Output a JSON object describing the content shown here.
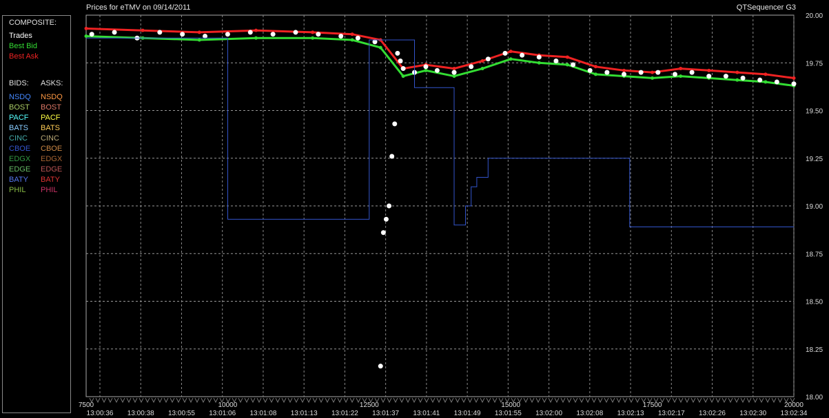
{
  "header": {
    "title": "Prices for  eTMV  on  09/14/2011",
    "app": "QTSequencer G3"
  },
  "legend": {
    "composite_heading": "COMPOSITE:",
    "composite": [
      {
        "label": "Trades",
        "color": "#ffffff"
      },
      {
        "label": "Best Bid",
        "color": "#33dd33"
      },
      {
        "label": "Best Ask",
        "color": "#ee2222"
      }
    ],
    "bids_heading": "BIDS:",
    "asks_heading": "ASKS:",
    "bids": [
      {
        "label": "NSDQ",
        "color": "#4488ff"
      },
      {
        "label": "BOST",
        "color": "#aacc66"
      },
      {
        "label": "PACF",
        "color": "#55ffff"
      },
      {
        "label": "BATS",
        "color": "#88ccff"
      },
      {
        "label": "CINC",
        "color": "#44aaaa"
      },
      {
        "label": "CBOE",
        "color": "#3355cc"
      },
      {
        "label": "EDGX",
        "color": "#339944"
      },
      {
        "label": "EDGE",
        "color": "#66bb66"
      },
      {
        "label": "BATY",
        "color": "#5577ee"
      },
      {
        "label": "PHIL",
        "color": "#88bb44"
      }
    ],
    "asks": [
      {
        "label": "NSDQ",
        "color": "#ff9944"
      },
      {
        "label": "BOST",
        "color": "#dd7766"
      },
      {
        "label": "PACF",
        "color": "#ffff44"
      },
      {
        "label": "BATS",
        "color": "#ffcc55"
      },
      {
        "label": "CINC",
        "color": "#bbaa77"
      },
      {
        "label": "CBOE",
        "color": "#cc8844"
      },
      {
        "label": "EDGX",
        "color": "#aa6633"
      },
      {
        "label": "EDGE",
        "color": "#bb5555"
      },
      {
        "label": "BATY",
        "color": "#dd3333"
      },
      {
        "label": "PHIL",
        "color": "#cc3366"
      }
    ]
  },
  "chart_data": {
    "type": "line",
    "ylim": [
      18.0,
      20.0
    ],
    "xlim": [
      7500,
      20000
    ],
    "yticks": [
      "20.00",
      "19.75",
      "19.50",
      "19.25",
      "19.00",
      "18.75",
      "18.50",
      "18.25",
      "18.00"
    ],
    "xticks_seq": [
      "7500",
      "10000",
      "12500",
      "15000",
      "17500",
      "20000"
    ],
    "xticks_seq_values": [
      7500,
      10000,
      12500,
      15000,
      17500,
      20000
    ],
    "xticks_time": [
      "13:00:36",
      "13:00:38",
      "13:00:55",
      "13:01:06",
      "13:01:08",
      "13:01:13",
      "13:01:22",
      "13:01:37",
      "13:01:41",
      "13:01:49",
      "13:01:55",
      "13:02:00",
      "13:02:08",
      "13:02:13",
      "13:02:17",
      "13:02:26",
      "13:02:30",
      "13:02:34"
    ],
    "grid": true,
    "series": [
      {
        "name": "Best Ask",
        "color": "#ee2222",
        "x": [
          7500,
          8500,
          9500,
          10500,
          11500,
          12200,
          12700,
          13100,
          13500,
          14000,
          14500,
          15000,
          15500,
          16000,
          16500,
          17000,
          17500,
          18000,
          18500,
          19000,
          19500,
          20000
        ],
        "y": [
          19.93,
          19.92,
          19.91,
          19.92,
          19.91,
          19.9,
          19.87,
          19.72,
          19.74,
          19.72,
          19.76,
          19.81,
          19.79,
          19.78,
          19.73,
          19.71,
          19.7,
          19.72,
          19.71,
          19.7,
          19.69,
          19.67
        ]
      },
      {
        "name": "Best Bid",
        "color": "#33dd33",
        "x": [
          7500,
          8500,
          9500,
          10500,
          11500,
          12200,
          12700,
          13100,
          13500,
          14000,
          14500,
          15000,
          15500,
          16000,
          16500,
          17000,
          17500,
          18000,
          18500,
          19000,
          19500,
          20000
        ],
        "y": [
          19.89,
          19.88,
          19.87,
          19.88,
          19.88,
          19.87,
          19.83,
          19.68,
          19.71,
          19.68,
          19.72,
          19.77,
          19.75,
          19.74,
          19.69,
          19.68,
          19.67,
          19.68,
          19.67,
          19.66,
          19.65,
          19.63
        ]
      },
      {
        "name": "Trades",
        "color": "#ffffff",
        "x": [
          7600,
          8000,
          8400,
          8800,
          9200,
          9600,
          10000,
          10400,
          10800,
          11200,
          11600,
          12000,
          12300,
          12600,
          12700,
          12750,
          12800,
          12850,
          12900,
          12950,
          13000,
          13050,
          13100,
          13300,
          13500,
          13700,
          14000,
          14300,
          14600,
          14900,
          15200,
          15500,
          15800,
          16100,
          16400,
          16700,
          17000,
          17300,
          17600,
          17900,
          18200,
          18500,
          18800,
          19100,
          19400,
          19700,
          20000
        ],
        "y": [
          19.9,
          19.91,
          19.88,
          19.91,
          19.9,
          19.89,
          19.9,
          19.91,
          19.9,
          19.91,
          19.9,
          19.89,
          19.88,
          19.86,
          18.16,
          18.86,
          18.93,
          19.0,
          19.26,
          19.43,
          19.8,
          19.76,
          19.72,
          19.7,
          19.73,
          19.71,
          19.7,
          19.73,
          19.77,
          19.8,
          19.79,
          19.78,
          19.76,
          19.74,
          19.71,
          19.7,
          19.69,
          19.7,
          19.7,
          19.69,
          19.7,
          19.68,
          19.68,
          19.67,
          19.66,
          19.65,
          19.64
        ]
      },
      {
        "name": "CBOE",
        "color": "#3355cc",
        "x": [
          7500,
          9800,
          10000,
          10001,
          12500,
          13300,
          13500,
          14000,
          14200,
          14300,
          14400,
          14600,
          15000,
          17000,
          17100,
          17101,
          20000
        ],
        "y": [
          19.88,
          19.88,
          19.87,
          18.93,
          19.87,
          19.62,
          19.62,
          18.9,
          19.0,
          19.1,
          19.15,
          19.25,
          19.25,
          19.25,
          19.25,
          18.89,
          18.89
        ]
      }
    ]
  }
}
